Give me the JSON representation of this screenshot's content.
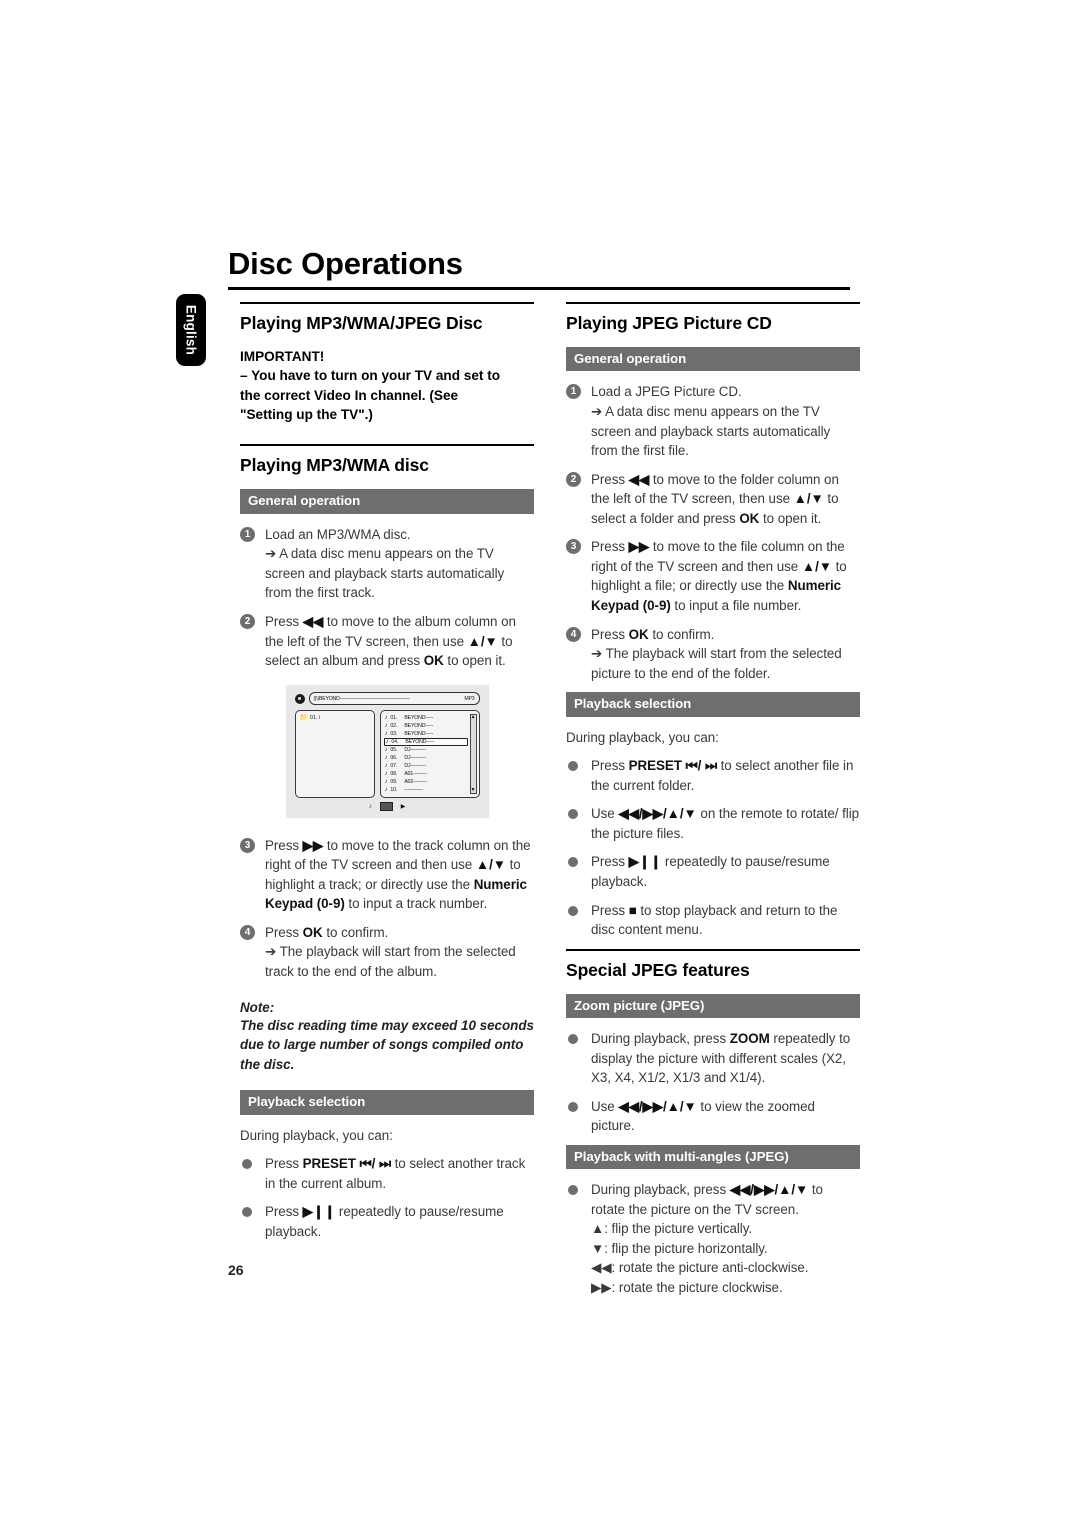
{
  "page": {
    "chapter_title": "Disc Operations",
    "language_tab": "English",
    "page_number": "26"
  },
  "left_column": {
    "section1": {
      "heading": "Playing MP3/WMA/JPEG Disc",
      "important_label": "IMPORTANT!",
      "important_line1": "–   You have to turn on your TV and set to",
      "important_line2": "the correct Video In channel. (See",
      "important_line3": "\"Setting up the TV\".)"
    },
    "section2": {
      "heading": "Playing MP3/WMA disc",
      "bar_general": "General operation",
      "steps": [
        {
          "num": "1",
          "text": "Load an MP3/WMA disc.",
          "arrow": "➔ A data disc menu appears on the TV screen and playback starts automatically from the first track."
        },
        {
          "num": "2",
          "text_a": "Press ",
          "sym_a": "◀◀",
          "text_b": " to move to the album column on the left of the TV screen, then use ",
          "sym_b": "▲/▼",
          "text_c": " to select an album and press ",
          "bold_ok": "OK",
          "text_d": " to open it."
        },
        {
          "num": "3",
          "text_a": "Press ",
          "sym_a": "▶▶",
          "text_b": " to move to the track column on the right of the TV screen and then use ",
          "sym_b": "▲/▼",
          "text_c": " to highlight a track; or directly use the ",
          "bold_a": "Numeric Keypad (0-9)",
          "text_d": " to input a track number."
        },
        {
          "num": "4",
          "text_a": "Press ",
          "bold_ok": "OK",
          "text_b": " to confirm.",
          "arrow": "➔ The playback will start from the selected track to the end of the album."
        }
      ],
      "note_label": "Note:",
      "note_text": "The disc reading time may exceed 10 seconds due to large number of songs compiled onto the disc.",
      "bar_playback": "Playback selection",
      "playback_intro": "During playback, you can:",
      "bullets": [
        {
          "text_a": "Press ",
          "bold_a": "PRESET",
          "sym_a": " ⏮/ ⏭",
          "text_b": " to select another track in the current album."
        },
        {
          "text_a": "Press ",
          "sym_a": "▶❙❙",
          "text_b": " repeatedly to pause/resume playback."
        }
      ]
    },
    "tv_illustration": {
      "disc_icon": "disc-icon",
      "path_prefix": "(|\\)BEYOND",
      "path_dashes": "——————————————",
      "path_format": "MP3",
      "folder_entry": "01.  \\",
      "files": [
        {
          "num": "01.",
          "name": "BEYOND-----",
          "selected": false
        },
        {
          "num": "02.",
          "name": "BEYOND-----",
          "selected": false
        },
        {
          "num": "03.",
          "name": "BEYOND-----",
          "selected": false
        },
        {
          "num": "04.",
          "name": "BEYOND-----",
          "selected": true
        },
        {
          "num": "05.",
          "name": "DJ----------",
          "selected": false
        },
        {
          "num": "06.",
          "name": "DJ----------",
          "selected": false
        },
        {
          "num": "07.",
          "name": "DJ----------",
          "selected": false
        },
        {
          "num": "08.",
          "name": "A01---------",
          "selected": false
        },
        {
          "num": "09.",
          "name": "A02---------",
          "selected": false
        },
        {
          "num": "10.",
          "name": "------------",
          "selected": false
        }
      ],
      "scroll_up": "▲",
      "scroll_down": "▼",
      "footer_note_icon": "♪",
      "footer_pause_icon": "pause-icon",
      "footer_play_icon": "▶"
    }
  },
  "right_column": {
    "section1": {
      "heading": "Playing JPEG Picture CD",
      "bar_general": "General operation",
      "steps": [
        {
          "num": "1",
          "text": "Load a JPEG Picture CD.",
          "arrow": "➔ A data disc menu appears on the TV screen and playback starts automatically from the first file."
        },
        {
          "num": "2",
          "text_a": "Press ",
          "sym_a": "◀◀",
          "text_b": " to move to the folder column on the left of the TV screen, then use ",
          "sym_b": "▲/▼",
          "text_c": " to select a folder and press ",
          "bold_ok": "OK",
          "text_d": " to open it."
        },
        {
          "num": "3",
          "text_a": "Press ",
          "sym_a": "▶▶",
          "text_b": " to move to the file column on the right of the TV screen and then use ",
          "sym_b": "▲/▼",
          "text_c": " to highlight a file; or directly use the ",
          "bold_a": "Numeric Keypad (0-9)",
          "text_d": " to input a file number."
        },
        {
          "num": "4",
          "text_a": "Press ",
          "bold_ok": "OK",
          "text_b": " to confirm.",
          "arrow": "➔ The playback will start from the selected picture to the end of the folder."
        }
      ],
      "bar_playback": "Playback selection",
      "playback_intro": "During playback, you can:",
      "bullets": [
        {
          "text_a": "Press ",
          "bold_a": "PRESET",
          "sym_a": " ⏮/ ⏭",
          "text_b": " to select another file in the current folder."
        },
        {
          "text_a": "Use ",
          "sym_a": "◀◀/▶▶/▲/▼",
          "text_b": " on the remote to rotate/ flip the picture files."
        },
        {
          "text_a": "Press ",
          "sym_a": "▶❙❙",
          "text_b": " repeatedly to pause/resume playback."
        },
        {
          "text_a": "Press ",
          "sym_a": "■",
          "text_b": " to stop playback and return to the disc content menu."
        }
      ]
    },
    "section2": {
      "heading": "Special JPEG features",
      "bar_zoom": "Zoom picture (JPEG)",
      "zoom_bullets": [
        {
          "text_a": "During playback, press ",
          "bold_a": "ZOOM",
          "text_b": " repeatedly to display the picture with different scales (X2, X3, X4, X1/2, X1/3 and X1/4)."
        },
        {
          "text_a": "Use ",
          "sym_a": "◀◀/▶▶/▲/▼",
          "text_b": " to view the zoomed picture."
        }
      ],
      "bar_multiangle": "Playback with multi-angles (JPEG)",
      "multiangle_bullet": {
        "text_a": "During playback, press ",
        "sym_a": "◀◀/▶▶/▲/▼",
        "text_b": " to rotate the picture on the TV screen."
      },
      "multiangle_keys": [
        "▲: flip the picture vertically.",
        "▼: flip the picture horizontally.",
        "◀◀: rotate the picture anti-clockwise.",
        "▶▶: rotate the picture clockwise."
      ]
    }
  },
  "colors": {
    "bar_gray": "#6e6e6e",
    "text_gray": "#3a3a3a",
    "black": "#000000"
  }
}
